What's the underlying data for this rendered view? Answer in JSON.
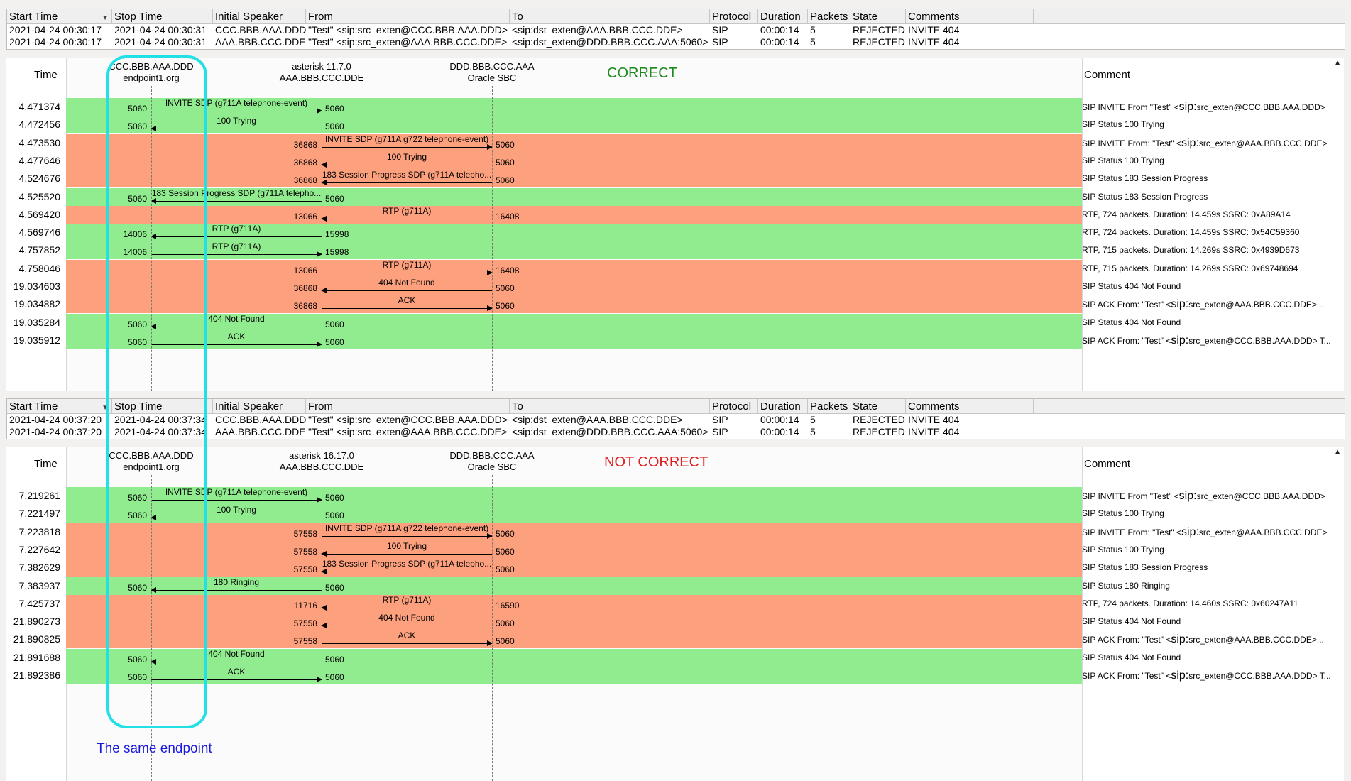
{
  "columns": [
    "Start Time",
    "Stop Time",
    "Initial Speaker",
    "From",
    "To",
    "Protocol",
    "Duration",
    "Packets",
    "State",
    "Comments"
  ],
  "calls_top": [
    {
      "start": "2021-04-24 00:30:17",
      "stop": "2021-04-24 00:30:31",
      "speaker": "CCC.BBB.AAA.DDD",
      "from": "\"Test\" <sip:src_exten@CCC.BBB.AAA.DDD>",
      "to": "<sip:dst_exten@AAA.BBB.CCC.DDE>",
      "protocol": "SIP",
      "duration": "00:00:14",
      "packets": "5",
      "state": "REJECTED",
      "comments": "INVITE 404"
    },
    {
      "start": "2021-04-24 00:30:17",
      "stop": "2021-04-24 00:30:31",
      "speaker": "AAA.BBB.CCC.DDE",
      "from": "\"Test\" <sip:src_exten@AAA.BBB.CCC.DDE>",
      "to": "<sip:dst_exten@DDD.BBB.CCC.AAA:5060>",
      "protocol": "SIP",
      "duration": "00:00:14",
      "packets": "5",
      "state": "REJECTED",
      "comments": "INVITE 404"
    }
  ],
  "calls_bottom": [
    {
      "start": "2021-04-24 00:37:20",
      "stop": "2021-04-24 00:37:34",
      "speaker": "CCC.BBB.AAA.DDD",
      "from": "\"Test\" <sip:src_exten@CCC.BBB.AAA.DDD>",
      "to": "<sip:dst_exten@AAA.BBB.CCC.DDE>",
      "protocol": "SIP",
      "duration": "00:00:14",
      "packets": "5",
      "state": "REJECTED",
      "comments": "INVITE 404"
    },
    {
      "start": "2021-04-24 00:37:20",
      "stop": "2021-04-24 00:37:34",
      "speaker": "AAA.BBB.CCC.DDE",
      "from": "\"Test\" <sip:src_exten@AAA.BBB.CCC.DDE>",
      "to": "<sip:dst_exten@DDD.BBB.CCC.AAA:5060>",
      "protocol": "SIP",
      "duration": "00:00:14",
      "packets": "5",
      "state": "REJECTED",
      "comments": "INVITE 404"
    }
  ],
  "flow_labels": {
    "time": "Time",
    "comment": "Comment"
  },
  "flow_top": {
    "verdict": "CORRECT",
    "verdict_color": "#1a8a1a",
    "hosts": [
      {
        "line1": "CCC.BBB.AAA.DDD",
        "line2": "endpoint1.org"
      },
      {
        "line1": "asterisk 11.7.0",
        "line2": "AAA.BBB.CCC.DDE"
      },
      {
        "line1": "DDD.BBB.CCC.AAA",
        "line2": "Oracle SBC"
      }
    ],
    "rows": [
      {
        "time": "4.471374",
        "color": "g",
        "from": 0,
        "to": 1,
        "label": "INVITE SDP (g711A telephone-event)",
        "p_left": "5060",
        "p_right": "5060",
        "comment": "SIP INVITE From  \"Test\" <sip:src_exten@CCC.BBB.AAA.DDD>"
      },
      {
        "time": "4.472456",
        "color": "g",
        "from": 1,
        "to": 0,
        "label": "100 Trying",
        "p_left": "5060",
        "p_right": "5060",
        "comment": "SIP Status 100 Trying"
      },
      {
        "time": "4.473530",
        "color": "r",
        "from": 1,
        "to": 2,
        "label": "INVITE SDP (g711A g722 telephone-event)",
        "p_left": "36868",
        "p_right": "5060",
        "comment": "SIP INVITE From: \"Test\" <sip:src_exten@AAA.BBB.CCC.DDE>"
      },
      {
        "time": "4.477646",
        "color": "r",
        "from": 2,
        "to": 1,
        "label": "100 Trying",
        "p_left": "36868",
        "p_right": "5060",
        "comment": "SIP Status 100 Trying"
      },
      {
        "time": "4.524676",
        "color": "r",
        "from": 2,
        "to": 1,
        "label": "183 Session Progress SDP (g711A telepho...",
        "p_left": "36868",
        "p_right": "5060",
        "comment": "SIP Status 183 Session Progress"
      },
      {
        "time": "4.525520",
        "color": "g",
        "from": 1,
        "to": 0,
        "label": "183 Session Progress SDP (g711A telepho...",
        "p_left": "5060",
        "p_right": "5060",
        "comment": "SIP Status 183 Session Progress"
      },
      {
        "time": "4.569420",
        "color": "r",
        "from": 2,
        "to": 1,
        "label": "RTP (g711A)",
        "p_left": "13066",
        "p_right": "16408",
        "comment": "RTP, 724 packets. Duration: 14.459s SSRC: 0xA89A14"
      },
      {
        "time": "4.569746",
        "color": "g",
        "from": 1,
        "to": 0,
        "label": "RTP (g711A)",
        "p_left": "14006",
        "p_right": "15998",
        "comment": "RTP, 724 packets. Duration: 14.459s SSRC: 0x54C59360"
      },
      {
        "time": "4.757852",
        "color": "g",
        "from": 0,
        "to": 1,
        "label": "RTP (g711A)",
        "p_left": "14006",
        "p_right": "15998",
        "comment": "RTP, 715 packets. Duration: 14.269s SSRC: 0x4939D673"
      },
      {
        "time": "4.758046",
        "color": "r",
        "from": 1,
        "to": 2,
        "label": "RTP (g711A)",
        "p_left": "13066",
        "p_right": "16408",
        "comment": "RTP, 715 packets. Duration: 14.269s SSRC: 0x69748694"
      },
      {
        "time": "19.034603",
        "color": "r",
        "from": 2,
        "to": 1,
        "label": "404 Not Found",
        "p_left": "36868",
        "p_right": "5060",
        "comment": "SIP Status 404 Not Found"
      },
      {
        "time": "19.034882",
        "color": "r",
        "from": 1,
        "to": 2,
        "label": "ACK",
        "p_left": "36868",
        "p_right": "5060",
        "comment": "SIP ACK From: \"Test\" <sip:src_exten@AAA.BBB.CCC.DDE>..."
      },
      {
        "time": "19.035284",
        "color": "g",
        "from": 1,
        "to": 0,
        "label": "404 Not Found",
        "p_left": "5060",
        "p_right": "5060",
        "comment": "SIP Status 404 Not Found"
      },
      {
        "time": "19.035912",
        "color": "g",
        "from": 0,
        "to": 1,
        "label": "ACK",
        "p_left": "5060",
        "p_right": "5060",
        "comment": "SIP ACK From: \"Test\" <sip:src_exten@CCC.BBB.AAA.DDD> T..."
      }
    ]
  },
  "flow_bottom": {
    "verdict": "NOT CORRECT",
    "verdict_color": "#e02020",
    "hosts": [
      {
        "line1": "CCC.BBB.AAA.DDD",
        "line2": "endpoint1.org"
      },
      {
        "line1": "asterisk 16.17.0",
        "line2": "AAA.BBB.CCC.DDE"
      },
      {
        "line1": "DDD.BBB.CCC.AAA",
        "line2": "Oracle SBC"
      }
    ],
    "rows": [
      {
        "time": "7.219261",
        "color": "g",
        "from": 0,
        "to": 1,
        "label": "INVITE SDP (g711A telephone-event)",
        "p_left": "5060",
        "p_right": "5060",
        "comment": "SIP INVITE From  \"Test\" <sip:src_exten@CCC.BBB.AAA.DDD>"
      },
      {
        "time": "7.221497",
        "color": "g",
        "from": 1,
        "to": 0,
        "label": "100 Trying",
        "p_left": "5060",
        "p_right": "5060",
        "comment": "SIP Status 100 Trying"
      },
      {
        "time": "7.223818",
        "color": "r",
        "from": 1,
        "to": 2,
        "label": "INVITE SDP (g711A g722 telephone-event)",
        "p_left": "57558",
        "p_right": "5060",
        "comment": "SIP INVITE From: \"Test\" <sip:src_exten@AAA.BBB.CCC.DDE>"
      },
      {
        "time": "7.227642",
        "color": "r",
        "from": 2,
        "to": 1,
        "label": "100 Trying",
        "p_left": "57558",
        "p_right": "5060",
        "comment": "SIP Status 100 Trying"
      },
      {
        "time": "7.382629",
        "color": "r",
        "from": 2,
        "to": 1,
        "label": "183 Session Progress SDP (g711A telepho...",
        "p_left": "57558",
        "p_right": "5060",
        "comment": "SIP Status 183 Session Progress"
      },
      {
        "time": "7.383937",
        "color": "g",
        "from": 1,
        "to": 0,
        "label": "180 Ringing",
        "p_left": "5060",
        "p_right": "5060",
        "comment": "SIP Status 180 Ringing"
      },
      {
        "time": "7.425737",
        "color": "r",
        "from": 2,
        "to": 1,
        "label": "RTP (g711A)",
        "p_left": "11716",
        "p_right": "16590",
        "comment": "RTP, 724 packets. Duration: 14.460s SSRC: 0x60247A11"
      },
      {
        "time": "21.890273",
        "color": "r",
        "from": 2,
        "to": 1,
        "label": "404 Not Found",
        "p_left": "57558",
        "p_right": "5060",
        "comment": "SIP Status 404 Not Found"
      },
      {
        "time": "21.890825",
        "color": "r",
        "from": 1,
        "to": 2,
        "label": "ACK",
        "p_left": "57558",
        "p_right": "5060",
        "comment": "SIP ACK From: \"Test\" <sip:src_exten@AAA.BBB.CCC.DDE>..."
      },
      {
        "time": "21.891688",
        "color": "g",
        "from": 1,
        "to": 0,
        "label": "404 Not Found",
        "p_left": "5060",
        "p_right": "5060",
        "comment": "SIP Status 404 Not Found"
      },
      {
        "time": "21.892386",
        "color": "g",
        "from": 0,
        "to": 1,
        "label": "ACK",
        "p_left": "5060",
        "p_right": "5060",
        "comment": "SIP ACK From: \"Test\" <sip:src_exten@CCC.BBB.AAA.DDD> T..."
      }
    ]
  },
  "note": "The same endpoint",
  "highlight_color": "#22e0e6"
}
